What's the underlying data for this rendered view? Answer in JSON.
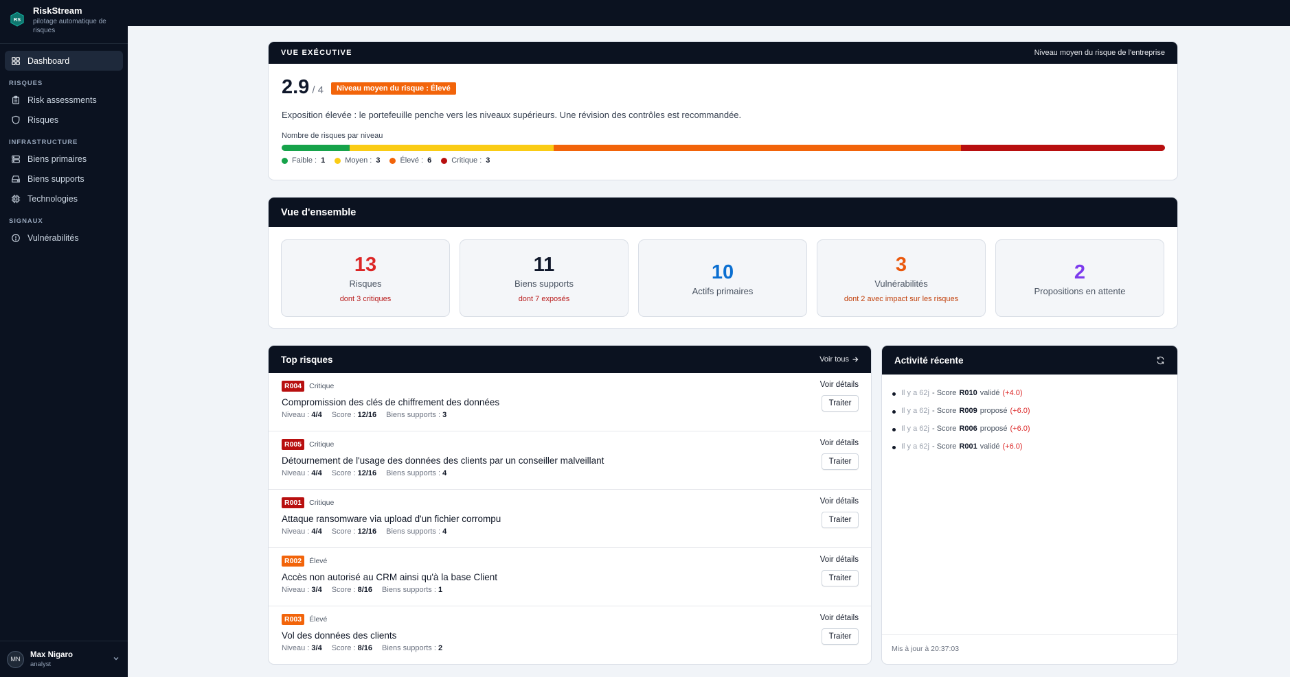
{
  "app": {
    "name": "RiskStream",
    "tagline": "pilotage automatique de risques",
    "logo_text": "RS"
  },
  "sidebar": {
    "dashboard": "Dashboard",
    "section_risques": "RISQUES",
    "risk_assessments": "Risk assessments",
    "risques": "Risques",
    "section_infrastructure": "INFRASTRUCTURE",
    "biens_primaires": "Biens primaires",
    "biens_supports": "Biens supports",
    "technologies": "Technologies",
    "section_signaux": "SIGNAUX",
    "vulnerabilites": "Vulnérabilités"
  },
  "user": {
    "initials": "MN",
    "name": "Max Nigaro",
    "role": "analyst"
  },
  "executive": {
    "title": "VUE EXÉCUTIVE",
    "header_right": "Niveau moyen du risque de l'entreprise",
    "score": "2.9",
    "score_max": "/ 4",
    "badge": "Niveau moyen du risque : Élevé",
    "description": "Exposition élevée : le portefeuille penche vers les niveaux supérieurs. Une révision des contrôles est recommandée.",
    "bar_label": "Nombre de risques par niveau",
    "levels": [
      {
        "label": "Faible :",
        "count": 1,
        "color": "#16a34a"
      },
      {
        "label": "Moyen :",
        "count": 3,
        "color": "#facc15"
      },
      {
        "label": "Élevé :",
        "count": 6,
        "color": "#f2640a"
      },
      {
        "label": "Critique :",
        "count": 3,
        "color": "#b80f0f"
      }
    ]
  },
  "overview": {
    "title": "Vue d'ensemble",
    "stats": [
      {
        "value": "13",
        "label": "Risques",
        "sub": "dont 3 critiques",
        "value_color": "#dc2626",
        "sub_color": "#b91c1c"
      },
      {
        "value": "11",
        "label": "Biens supports",
        "sub": "dont 7 exposés",
        "value_color": "#0f172a",
        "sub_color": "#b91c1c"
      },
      {
        "value": "10",
        "label": "Actifs primaires",
        "sub": "",
        "value_color": "#0b6fd1",
        "sub_color": "#b91c1c"
      },
      {
        "value": "3",
        "label": "Vulnérabilités",
        "sub": "dont 2 avec impact sur les risques",
        "value_color": "#ea580c",
        "sub_color": "#c2410c"
      },
      {
        "value": "2",
        "label": "Propositions en attente",
        "sub": "",
        "value_color": "#7c3aed",
        "sub_color": "#b91c1c"
      }
    ]
  },
  "top_risks": {
    "title": "Top risques",
    "view_all": "Voir tous",
    "details_label": "Voir détails",
    "action_label": "Traiter",
    "niveau_label": "Niveau :",
    "score_label": "Score :",
    "biens_label": "Biens supports :",
    "items": [
      {
        "id": "R004",
        "level": "Critique",
        "level_color": "#b80f0f",
        "title": "Compromission des clés de chiffrement des données",
        "niveau": "4/4",
        "score": "12/16",
        "biens": "3"
      },
      {
        "id": "R005",
        "level": "Critique",
        "level_color": "#b80f0f",
        "title": "Détournement de l'usage des données des clients par un conseiller malveillant",
        "niveau": "4/4",
        "score": "12/16",
        "biens": "4"
      },
      {
        "id": "R001",
        "level": "Critique",
        "level_color": "#b80f0f",
        "title": "Attaque ransomware via upload d'un fichier corrompu",
        "niveau": "4/4",
        "score": "12/16",
        "biens": "4"
      },
      {
        "id": "R002",
        "level": "Élevé",
        "level_color": "#f2640a",
        "title": "Accès non autorisé au CRM ainsi qu'à la base Client",
        "niveau": "3/4",
        "score": "8/16",
        "biens": "1"
      },
      {
        "id": "R003",
        "level": "Élevé",
        "level_color": "#f2640a",
        "title": "Vol des données des clients",
        "niveau": "3/4",
        "score": "8/16",
        "biens": "2"
      }
    ]
  },
  "activity": {
    "title": "Activité récente",
    "items": [
      {
        "time": "Il y a 62j",
        "prefix": "- Score",
        "code": "R010",
        "action": "validé",
        "delta": "(+4.0)"
      },
      {
        "time": "Il y a 62j",
        "prefix": "- Score",
        "code": "R009",
        "action": "proposé",
        "delta": "(+6.0)"
      },
      {
        "time": "Il y a 62j",
        "prefix": "- Score",
        "code": "R006",
        "action": "proposé",
        "delta": "(+6.0)"
      },
      {
        "time": "Il y a 62j",
        "prefix": "- Score",
        "code": "R001",
        "action": "validé",
        "delta": "(+6.0)"
      }
    ],
    "updated": "Mis à jour à 20:37:03"
  }
}
